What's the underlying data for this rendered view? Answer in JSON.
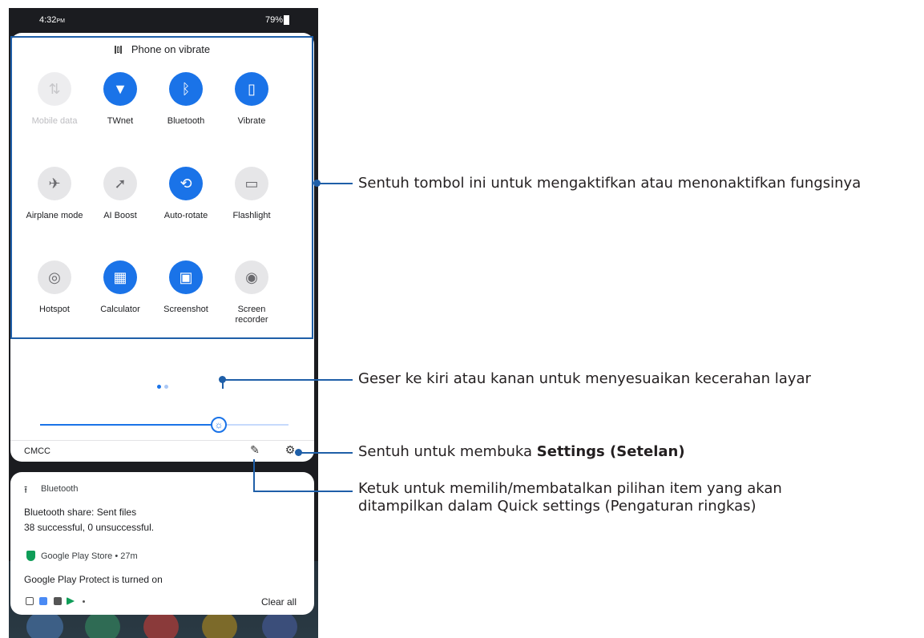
{
  "status_bar": {
    "time": "4:32",
    "ampm": "PM",
    "battery": "79%"
  },
  "quick_settings": {
    "header": "Phone on vibrate",
    "tiles": [
      {
        "label": "Mobile data",
        "icon": "mobile-data-icon",
        "glyph": "⇅",
        "state": "unavailable"
      },
      {
        "label": "TWnet",
        "icon": "wifi-icon",
        "glyph": "▼",
        "state": "on"
      },
      {
        "label": "Bluetooth",
        "icon": "bluetooth-icon",
        "glyph": "ᛒ",
        "state": "on"
      },
      {
        "label": "Vibrate",
        "icon": "vibrate-icon",
        "glyph": "▯",
        "state": "on"
      },
      {
        "label": "Airplane mode",
        "icon": "airplane-icon",
        "glyph": "✈",
        "state": "off"
      },
      {
        "label": "AI Boost",
        "icon": "rocket-icon",
        "glyph": "➚",
        "state": "off"
      },
      {
        "label": "Auto-rotate",
        "icon": "rotate-icon",
        "glyph": "⟲",
        "state": "on"
      },
      {
        "label": "Flashlight",
        "icon": "flashlight-icon",
        "glyph": "▭",
        "state": "off"
      },
      {
        "label": "Hotspot",
        "icon": "hotspot-icon",
        "glyph": "◎",
        "state": "off"
      },
      {
        "label": "Calculator",
        "icon": "calculator-icon",
        "glyph": "▦",
        "state": "on"
      },
      {
        "label": "Screenshot",
        "icon": "screenshot-icon",
        "glyph": "▣",
        "state": "on"
      },
      {
        "label": "Screen\nrecorder",
        "icon": "screen-recorder-icon",
        "glyph": "◉",
        "state": "off"
      }
    ],
    "brightness": 0.72,
    "carrier": "CMCC"
  },
  "notifications": {
    "bluetooth": {
      "app": "Bluetooth",
      "title": "Bluetooth share: Sent files",
      "body": "38 successful, 0 unsuccessful."
    },
    "play": {
      "app": "Google Play Store • 27m",
      "title": "Google Play Protect is turned on"
    },
    "clear_all": "Clear all"
  },
  "annotations": {
    "tiles": "Sentuh tombol ini untuk mengaktifkan atau menonaktifkan fungsinya",
    "brightness": "Geser ke kiri atau kanan untuk menyesuaikan kecerahan layar",
    "settings_prefix": "Sentuh untuk membuka ",
    "settings_bold": "Settings (Setelan)",
    "edit_line1": "Ketuk untuk memilih/membatalkan pilihan item yang akan",
    "edit_line2": "ditampilkan dalam Quick settings (Pengaturan ringkas)"
  },
  "colors": {
    "accent": "#1a73e8",
    "annotation": "#1f5fa8",
    "play_protect": "#0f9d58"
  }
}
